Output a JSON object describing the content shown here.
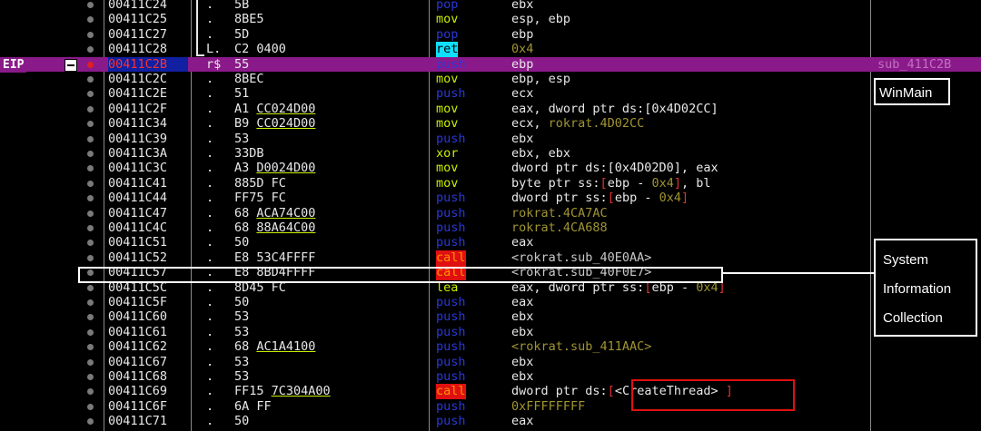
{
  "eip_label": "EIP",
  "rows": [
    {
      "addr": "00411C24",
      "sep": ".",
      "bytes": "5B",
      "mnem": "pop",
      "mclass": "m-b",
      "ops": [
        [
          "ebx",
          "o-w"
        ]
      ]
    },
    {
      "addr": "00411C25",
      "sep": ".",
      "bytes": "8BE5",
      "mnem": "mov",
      "mclass": "m-g",
      "ops": [
        [
          "esp, ebp",
          "o-w"
        ]
      ]
    },
    {
      "addr": "00411C27",
      "sep": ".",
      "bytes": "5D",
      "mnem": "pop",
      "mclass": "m-b",
      "ops": [
        [
          "ebp",
          "o-w"
        ]
      ]
    },
    {
      "addr": "00411C28",
      "sep": "L.",
      "bytes": "C2 0400",
      "mnem": "ret",
      "mclass": "m-retbg",
      "ops": [
        [
          "0x4",
          "o-br"
        ]
      ]
    },
    {
      "addr": "00411C2B",
      "sep": "r$",
      "bytes": "55",
      "mnem": "push",
      "mclass": "m-b",
      "ops": [
        [
          "ebp",
          "o-w"
        ]
      ],
      "eip": true,
      "comment": "sub_411C2B"
    },
    {
      "addr": "00411C2C",
      "sep": ".",
      "bytes": "8BEC",
      "mnem": "mov",
      "mclass": "m-g",
      "ops": [
        [
          "ebp, esp",
          "o-w"
        ]
      ]
    },
    {
      "addr": "00411C2E",
      "sep": ".",
      "bytes": "51",
      "mnem": "push",
      "mclass": "m-b",
      "ops": [
        [
          "ecx",
          "o-w"
        ]
      ]
    },
    {
      "addr": "00411C2F",
      "sep": ".",
      "bytes": "A1 CC024D00",
      "ul": "CC024D00",
      "mnem": "mov",
      "mclass": "m-g",
      "ops": [
        [
          "eax, dword ptr ds:[0x4D02CC]",
          "o-w"
        ]
      ]
    },
    {
      "addr": "00411C34",
      "sep": ".",
      "bytes": "B9 CC024D00",
      "ul": "CC024D00",
      "mnem": "mov",
      "mclass": "m-g",
      "ops": [
        [
          "ecx, ",
          "o-w"
        ],
        [
          "rokrat.4D02CC",
          "o-br"
        ]
      ]
    },
    {
      "addr": "00411C39",
      "sep": ".",
      "bytes": "53",
      "mnem": "push",
      "mclass": "m-b",
      "ops": [
        [
          "ebx",
          "o-w"
        ]
      ]
    },
    {
      "addr": "00411C3A",
      "sep": ".",
      "bytes": "33DB",
      "mnem": "xor",
      "mclass": "m-g",
      "ops": [
        [
          "ebx, ebx",
          "o-w"
        ]
      ]
    },
    {
      "addr": "00411C3C",
      "sep": ".",
      "bytes": "A3 D0024D00",
      "ul": "D0024D00",
      "mnem": "mov",
      "mclass": "m-g",
      "ops": [
        [
          "dword ptr ds:[0x4D02D0], eax",
          "o-w"
        ]
      ]
    },
    {
      "addr": "00411C41",
      "sep": ".",
      "bytes": "885D FC",
      "mnem": "mov",
      "mclass": "m-g",
      "ops": [
        [
          "byte ptr ss:",
          "o-w"
        ],
        [
          "[",
          "o-red"
        ],
        [
          "ebp - ",
          "o-w"
        ],
        [
          "0x4",
          "o-br"
        ],
        [
          "]",
          "o-red"
        ],
        [
          ", bl",
          "o-w"
        ]
      ]
    },
    {
      "addr": "00411C44",
      "sep": ".",
      "bytes": "FF75 FC",
      "mnem": "push",
      "mclass": "m-b",
      "ops": [
        [
          "dword ptr ss:",
          "o-w"
        ],
        [
          "[",
          "o-red"
        ],
        [
          "ebp - ",
          "o-w"
        ],
        [
          "0x4",
          "o-br"
        ],
        [
          "]",
          "o-red"
        ]
      ]
    },
    {
      "addr": "00411C47",
      "sep": ".",
      "bytes": "68 ACA74C00",
      "ul": "ACA74C00",
      "mnem": "push",
      "mclass": "m-b",
      "ops": [
        [
          "rokrat.4CA7AC",
          "o-br"
        ]
      ]
    },
    {
      "addr": "00411C4C",
      "sep": ".",
      "bytes": "68 88A64C00",
      "ul": "88A64C00",
      "mnem": "push",
      "mclass": "m-b",
      "ops": [
        [
          "rokrat.4CA688",
          "o-br"
        ]
      ]
    },
    {
      "addr": "00411C51",
      "sep": ".",
      "bytes": "50",
      "mnem": "push",
      "mclass": "m-b",
      "ops": [
        [
          "eax",
          "o-w"
        ]
      ]
    },
    {
      "addr": "00411C52",
      "sep": ".",
      "bytes": "E8 53C4FFFF",
      "mnem": "call",
      "mclass": "m-callbg",
      "ops": [
        [
          "<rokrat.sub_40E0AA>",
          "o-sub"
        ]
      ]
    },
    {
      "addr": "00411C57",
      "sep": ".",
      "bytes": "E8 8BD4FFFF",
      "mnem": "call",
      "mclass": "m-callbg",
      "ops": [
        [
          "<rokrat.sub_40F0E7>",
          "o-sub"
        ]
      ]
    },
    {
      "addr": "00411C5C",
      "sep": ".",
      "bytes": "8D45 FC",
      "mnem": "lea",
      "mclass": "m-g",
      "ops": [
        [
          "eax, dword ptr ss:",
          "o-w"
        ],
        [
          "[",
          "o-red"
        ],
        [
          "ebp - ",
          "o-w"
        ],
        [
          "0x4",
          "o-br"
        ],
        [
          "]",
          "o-red"
        ]
      ]
    },
    {
      "addr": "00411C5F",
      "sep": ".",
      "bytes": "50",
      "mnem": "push",
      "mclass": "m-b",
      "ops": [
        [
          "eax",
          "o-w"
        ]
      ]
    },
    {
      "addr": "00411C60",
      "sep": ".",
      "bytes": "53",
      "mnem": "push",
      "mclass": "m-b",
      "ops": [
        [
          "ebx",
          "o-w"
        ]
      ]
    },
    {
      "addr": "00411C61",
      "sep": ".",
      "bytes": "53",
      "mnem": "push",
      "mclass": "m-b",
      "ops": [
        [
          "ebx",
          "o-w"
        ]
      ]
    },
    {
      "addr": "00411C62",
      "sep": ".",
      "bytes": "68 AC1A4100",
      "ul": "AC1A4100",
      "mnem": "push",
      "mclass": "m-b",
      "ops": [
        [
          "<rokrat.sub_411AAC>",
          "o-br"
        ]
      ]
    },
    {
      "addr": "00411C67",
      "sep": ".",
      "bytes": "53",
      "mnem": "push",
      "mclass": "m-b",
      "ops": [
        [
          "ebx",
          "o-w"
        ]
      ]
    },
    {
      "addr": "00411C68",
      "sep": ".",
      "bytes": "53",
      "mnem": "push",
      "mclass": "m-b",
      "ops": [
        [
          "ebx",
          "o-w"
        ]
      ]
    },
    {
      "addr": "00411C69",
      "sep": ".",
      "bytes": "FF15 7C304A00",
      "ul": "7C304A00",
      "mnem": "call",
      "mclass": "m-callbg",
      "ops": [
        [
          "dword ptr ds:",
          "o-w"
        ],
        [
          "[",
          "o-red"
        ],
        [
          "<CreateThread>",
          "o-w"
        ],
        [
          " ]",
          "o-red"
        ]
      ]
    },
    {
      "addr": "00411C6F",
      "sep": ".",
      "bytes": "6A FF",
      "mnem": "push",
      "mclass": "m-b",
      "ops": [
        [
          "0xFFFFFFFF",
          "o-br"
        ]
      ]
    },
    {
      "addr": "00411C71",
      "sep": ".",
      "bytes": "50",
      "mnem": "push",
      "mclass": "m-b",
      "ops": [
        [
          "eax",
          "o-w"
        ]
      ]
    }
  ],
  "annotations": {
    "winmain": "WinMain",
    "sysinfo": [
      "System",
      "Information",
      "Collection"
    ]
  }
}
